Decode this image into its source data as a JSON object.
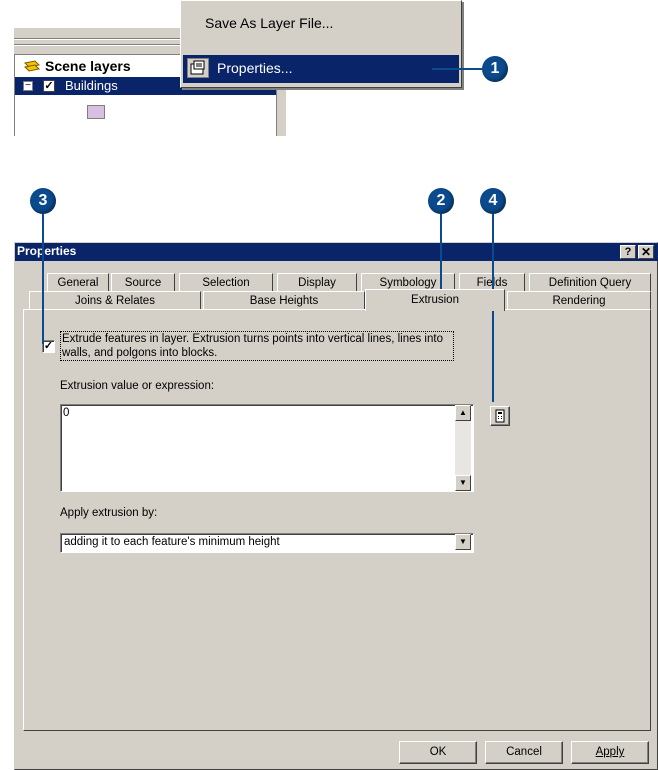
{
  "toc": {
    "root_label": "Scene layers",
    "layer_label": "Buildings"
  },
  "context_menu": {
    "items": [
      {
        "label": "Save As Layer File..."
      },
      {
        "label": "Properties..."
      }
    ]
  },
  "callouts": [
    "1",
    "2",
    "3",
    "4"
  ],
  "dialog": {
    "title": "Properties",
    "tabs_row1": [
      "General",
      "Source",
      "Selection",
      "Display",
      "Symbology",
      "Fields",
      "Definition Query"
    ],
    "tabs_row2": [
      "Joins & Relates",
      "Base Heights",
      "Extrusion",
      "Rendering"
    ],
    "extrude_checkbox_label": "Extrude features in layer.  Extrusion turns points into vertical lines, lines into walls, and polgons into blocks.",
    "extrusion_value_label": "Extrusion value or expression:",
    "extrusion_value": "0",
    "apply_label": "Apply extrusion by:",
    "apply_value": "adding it to each feature's minimum height",
    "buttons": {
      "ok": "OK",
      "cancel": "Cancel",
      "apply": "Apply"
    }
  },
  "colors": {
    "title_bar": "#0a246a",
    "dialog_bg": "#d4d0c8",
    "highlight": "#0a246a",
    "callout": "#0b4a8c",
    "swatch": "#d8c0e0"
  }
}
